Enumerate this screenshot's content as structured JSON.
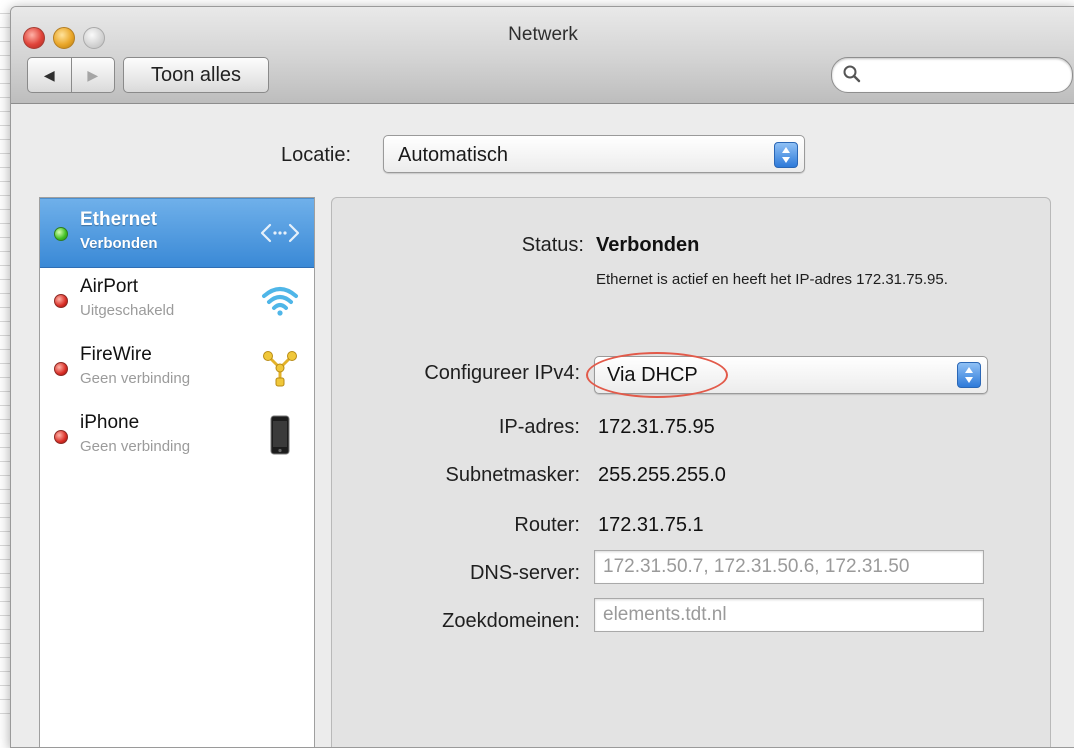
{
  "window": {
    "title": "Netwerk"
  },
  "toolbar": {
    "show_all_label": "Toon alles",
    "search_placeholder": ""
  },
  "location": {
    "label": "Locatie:",
    "value": "Automatisch"
  },
  "services": [
    {
      "name": "Ethernet",
      "status": "Verbonden",
      "state": "connected",
      "icon": "ethernet-icon",
      "selected": true
    },
    {
      "name": "AirPort",
      "status": "Uitgeschakeld",
      "state": "off",
      "icon": "wifi-icon",
      "selected": false
    },
    {
      "name": "FireWire",
      "status": "Geen verbinding",
      "state": "off",
      "icon": "firewire-icon",
      "selected": false
    },
    {
      "name": "iPhone",
      "status": "Geen verbinding",
      "state": "off",
      "icon": "iphone-icon",
      "selected": false
    }
  ],
  "detail": {
    "status_label": "Status:",
    "status_value": "Verbonden",
    "status_description": "Ethernet is actief en heeft het IP-adres 172.31.75.95.",
    "configure_label": "Configureer IPv4:",
    "configure_value": "Via DHCP",
    "ip_label": "IP-adres:",
    "ip_value": "172.31.75.95",
    "subnet_label": "Subnetmasker:",
    "subnet_value": "255.255.255.0",
    "router_label": "Router:",
    "router_value": "172.31.75.1",
    "dns_label": "DNS-server:",
    "dns_value": "172.31.50.7, 172.31.50.6, 172.31.50",
    "search_domains_label": "Zoekdomeinen:",
    "search_domains_value": "elements.tdt.nl"
  },
  "colors": {
    "selection": "#3a89d6",
    "highlight_ring": "#e25a4a",
    "status_connected": "#3fbf22",
    "status_off": "#d92d25"
  }
}
